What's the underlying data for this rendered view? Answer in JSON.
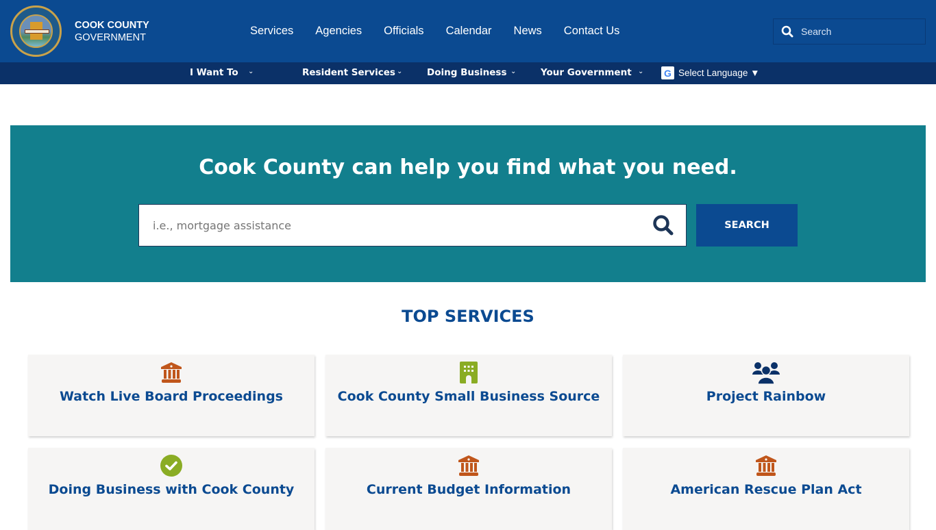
{
  "header": {
    "brand_line1": "COOK COUNTY",
    "brand_line2": "GOVERNMENT",
    "nav": [
      "Services",
      "Agencies",
      "Officials",
      "Calendar",
      "News",
      "Contact Us"
    ],
    "search_placeholder": "Search"
  },
  "subnav": {
    "items": [
      "I Want To",
      "Resident Services",
      "Doing Business",
      "Your Government"
    ],
    "language_label": "Select Language ▼"
  },
  "hero": {
    "title": "Cook County can help you find what you need.",
    "search_placeholder": "i.e., mortgage assistance",
    "search_button": "SEARCH"
  },
  "top_services": {
    "title": "TOP SERVICES",
    "cards": [
      {
        "label": "Watch Live Board Proceedings",
        "icon": "landmark-icon",
        "icon_color": "#c0561b"
      },
      {
        "label": "Cook County Small Business Source",
        "icon": "building-icon",
        "icon_color": "#8aac24"
      },
      {
        "label": "Project Rainbow",
        "icon": "users-icon",
        "icon_color": "#0b3168"
      },
      {
        "label": "Doing Business with Cook County",
        "icon": "check-circle-icon",
        "icon_color": "#8aac24"
      },
      {
        "label": "Current Budget Information",
        "icon": "landmark-icon",
        "icon_color": "#c0561b"
      },
      {
        "label": "American Rescue Plan Act",
        "icon": "landmark-icon",
        "icon_color": "#c0561b"
      }
    ]
  },
  "colors": {
    "header_blue": "#0b4a91",
    "subnav_navy": "#0b3168",
    "hero_teal": "#127f8d",
    "card_bg": "#f6f5f4"
  }
}
